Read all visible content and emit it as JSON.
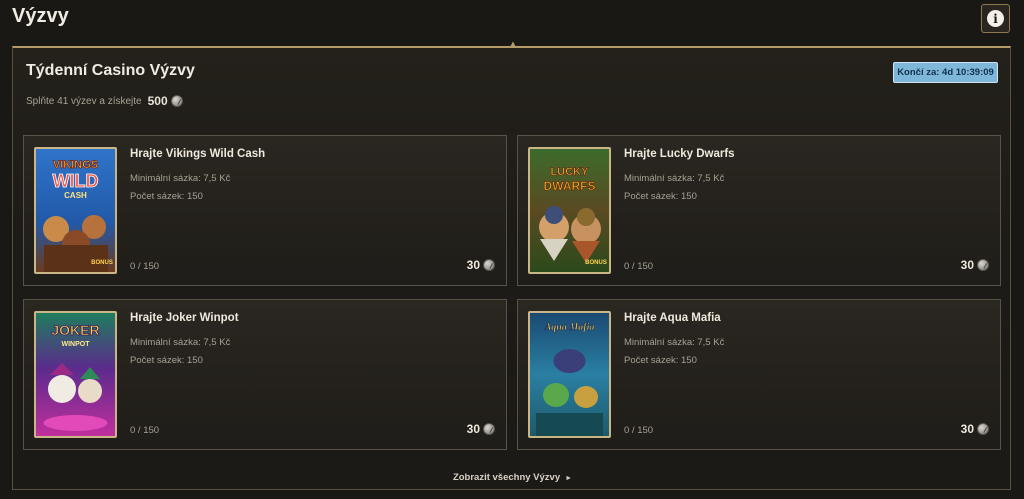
{
  "page": {
    "title": "Výzvy"
  },
  "header": {
    "info_icon": "info-icon",
    "info_glyph": "i"
  },
  "panel": {
    "title": "Týdenní Casino Výzvy",
    "subtitle": "Splňte 41 výzev a získejte",
    "subtitle_points": "500",
    "timer": "Končí za: 4d 10:39:09",
    "show_all_label": "Zobrazit všechny Výzvy",
    "show_all_arrow": "►"
  },
  "colors": {
    "timer_bg": "#7fb7da",
    "accent_gold": "#b49b68",
    "background": "#1a1815"
  },
  "cards": [
    {
      "title": "Hrajte Vikings Wild Cash",
      "min_bet": "Minimální sázka: 7,5 Kč",
      "bet_count": "Počet sázek: 150",
      "progress": "0 / 150",
      "reward": "30",
      "thumb_text_1": "VIKINGS",
      "thumb_text_2": "WILD",
      "thumb_text_3": "CASH",
      "thumb_badge": "BONUS"
    },
    {
      "title": "Hrajte Lucky Dwarfs",
      "min_bet": "Minimální sázka: 7,5 Kč",
      "bet_count": "Počet sázek: 150",
      "progress": "0 / 150",
      "reward": "30",
      "thumb_text_1": "LUCKY",
      "thumb_text_2": "DWARFS",
      "thumb_badge": "BONUS"
    },
    {
      "title": "Hrajte Joker Winpot",
      "min_bet": "Minimální sázka: 7,5 Kč",
      "bet_count": "Počet sázek: 150",
      "progress": "0 / 150",
      "reward": "30",
      "thumb_text_1": "JOKER",
      "thumb_text_2": "WINPOT"
    },
    {
      "title": "Hrajte Aqua Mafia",
      "min_bet": "Minimální sázka: 7,5 Kč",
      "bet_count": "Počet sázek: 150",
      "progress": "0 / 150",
      "reward": "30",
      "thumb_text_1": "Aqua Mafia"
    }
  ]
}
